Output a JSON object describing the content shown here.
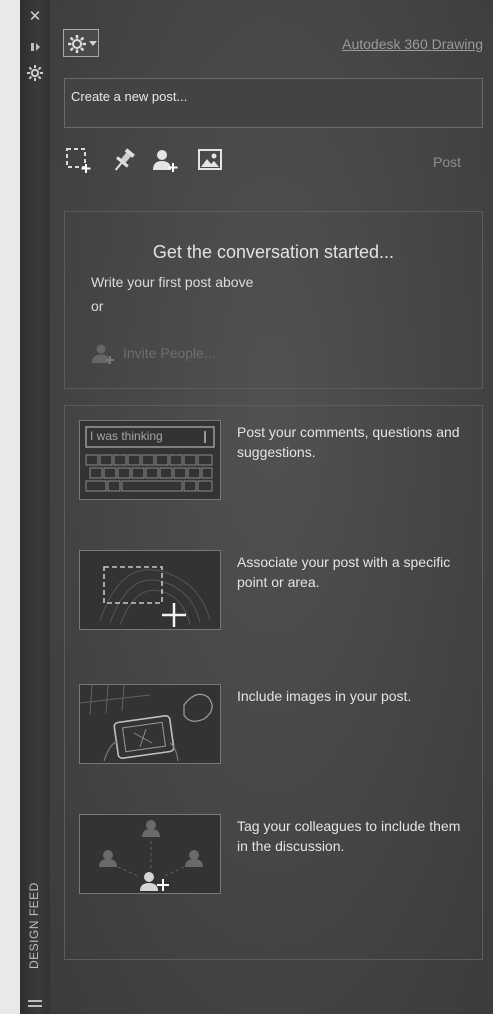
{
  "sidebar": {
    "label": "DESIGN FEED",
    "icons": [
      "close-icon",
      "pin-panel-icon",
      "settings-small-icon",
      "menu-lines-icon"
    ]
  },
  "header": {
    "title_link": "Autodesk 360 Drawing"
  },
  "composer": {
    "value": "Create a new post...",
    "post_label": "Post",
    "tools": [
      "select-area-icon",
      "pushpin-icon",
      "add-person-icon",
      "image-icon"
    ]
  },
  "intro": {
    "title": "Get the conversation started...",
    "subtitle": "Write your first post above",
    "or": "or",
    "invite": "Invite People..."
  },
  "tips": [
    {
      "text": "Post your comments, questions and suggestions.",
      "image_text": "I was thinking"
    },
    {
      "text": "Associate your post with a specific point or area."
    },
    {
      "text": "Include images in your post."
    },
    {
      "text": "Tag your colleagues to include them in the discussion."
    }
  ],
  "colors": {
    "panel": "#474747",
    "strip": "#333333",
    "text": "#e4e4e4",
    "muted": "#8e8e8e"
  }
}
